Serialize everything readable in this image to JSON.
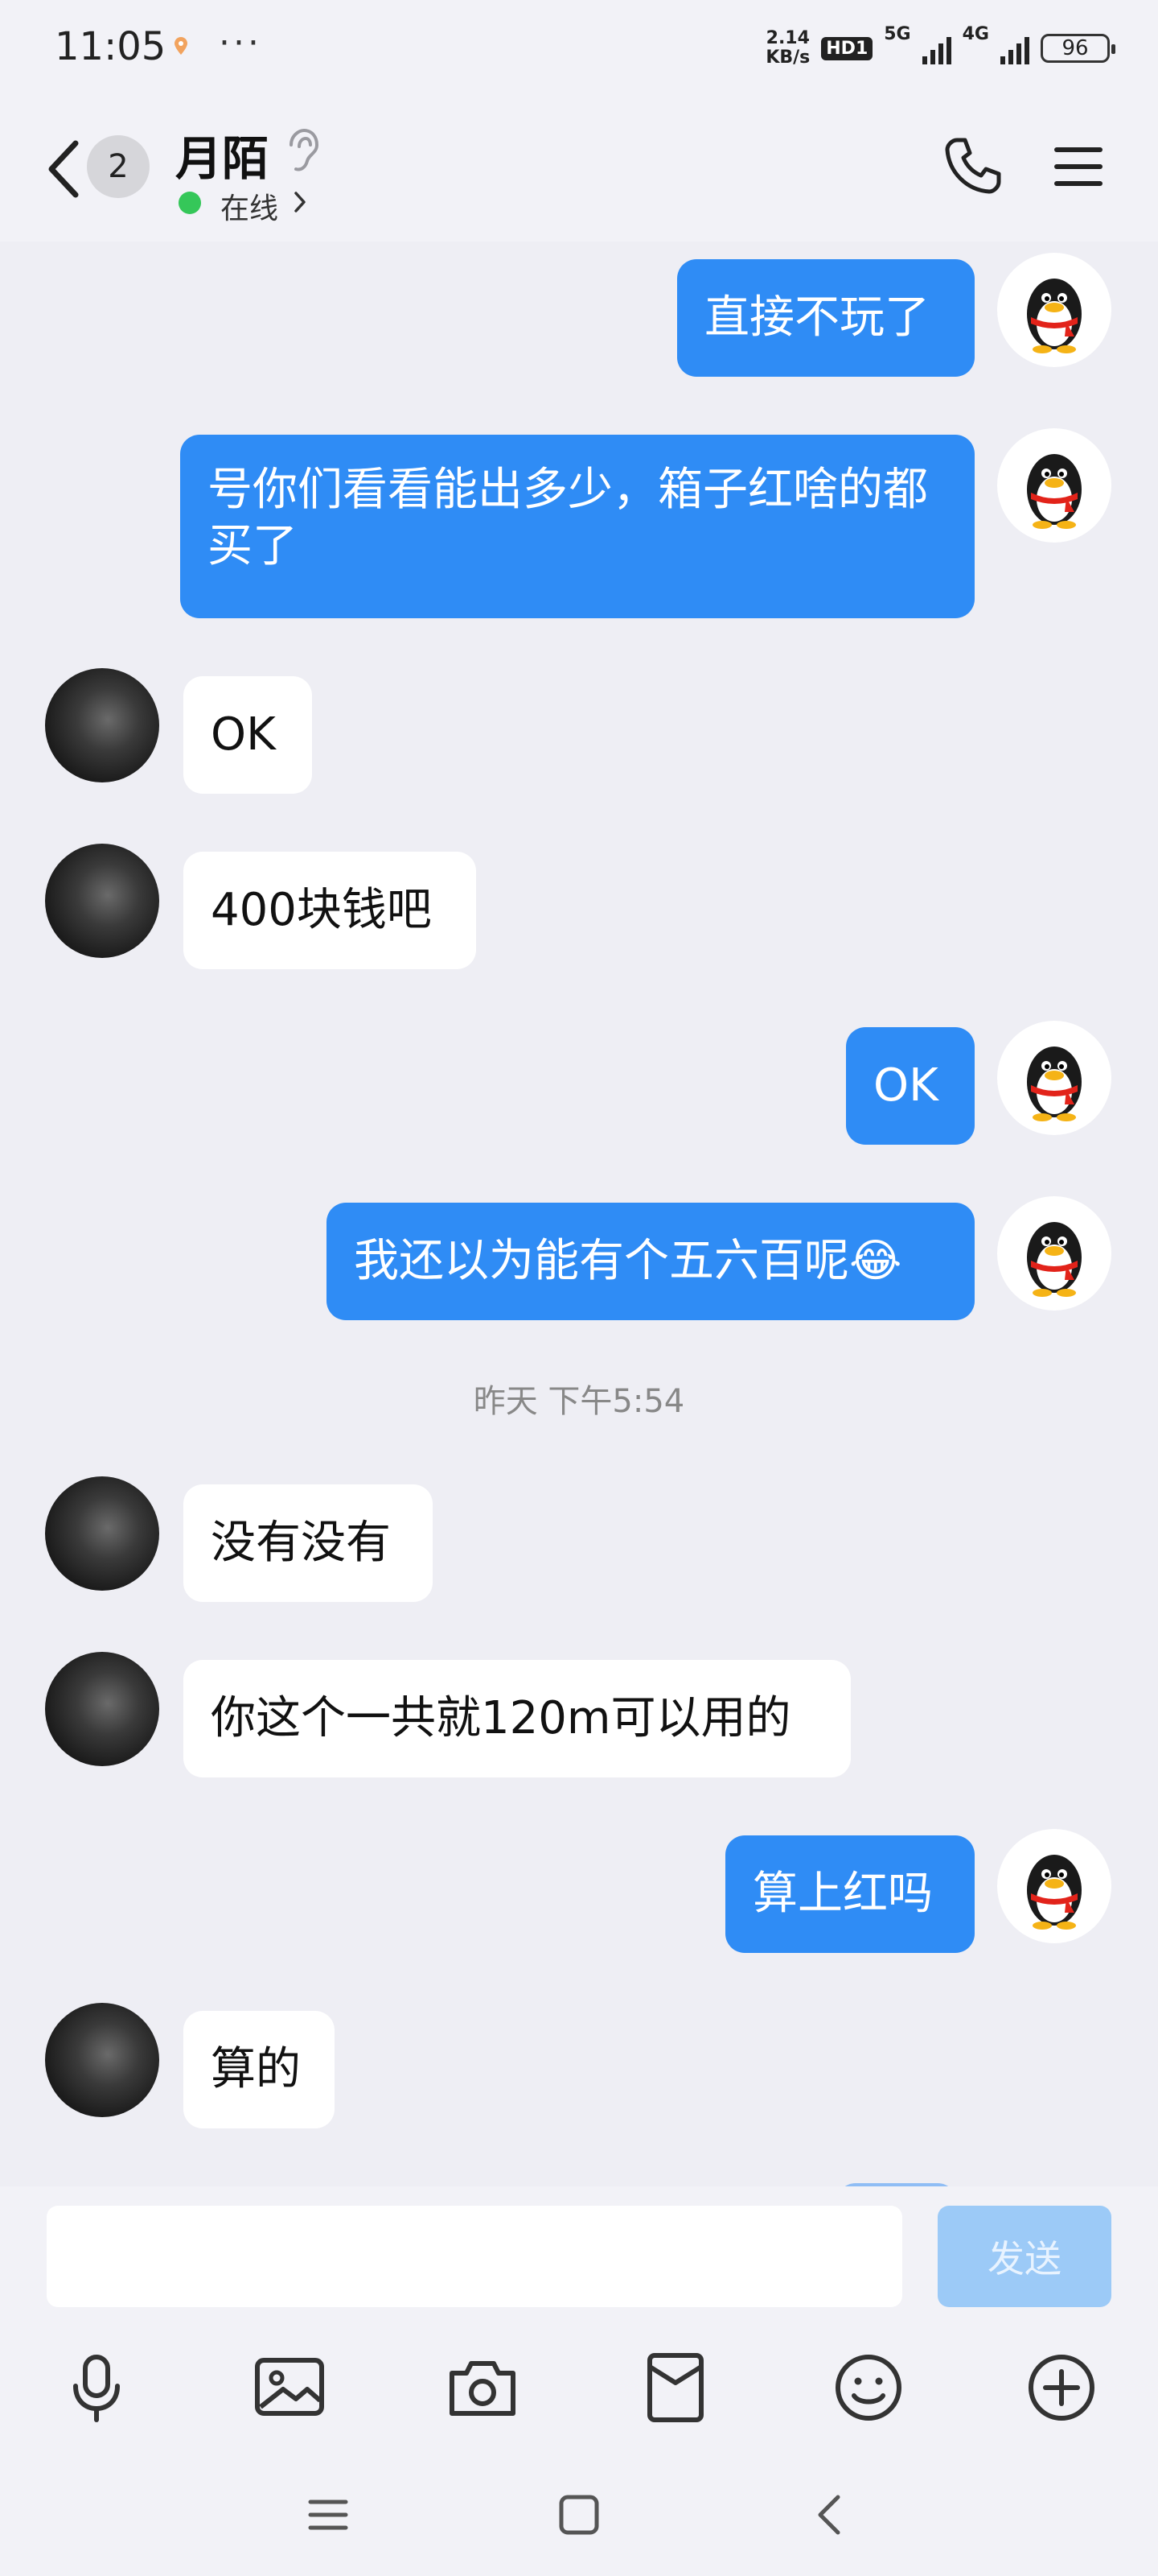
{
  "status_bar": {
    "time": "11:05",
    "dots": "···",
    "speed_top": "2.14",
    "speed_bottom": "KB/s",
    "hd": "HD1",
    "net1": "5G",
    "net2": "4G",
    "battery": "96"
  },
  "header": {
    "back_badge": "2",
    "contact_name": "月陌",
    "status": "在线"
  },
  "messages": [
    {
      "dir": "out",
      "text": "直接不玩了"
    },
    {
      "dir": "out",
      "text": "号你们看看能出多少，箱子红啥的都买了"
    },
    {
      "dir": "in",
      "text": "OK"
    },
    {
      "dir": "in",
      "text": "400块钱吧"
    },
    {
      "dir": "out",
      "text": "OK"
    },
    {
      "dir": "out",
      "text": "我还以为能有个五六百呢😂"
    },
    {
      "dir": "in",
      "text": "没有没有"
    },
    {
      "dir": "in",
      "text": "你这个一共就120m可以用的"
    },
    {
      "dir": "out",
      "text": "算上红吗"
    },
    {
      "dir": "in",
      "text": "算的"
    }
  ],
  "timestamp": "昨天 下午5:54",
  "input": {
    "placeholder": "",
    "value": "",
    "send_label": "发送"
  },
  "toolbar_icons": [
    "microphone-icon",
    "image-icon",
    "camera-icon",
    "red-packet-icon",
    "emoji-icon",
    "plus-icon"
  ],
  "nav_icons": [
    "menu-icon",
    "home-icon",
    "back-icon"
  ],
  "colors": {
    "outgoing_bubble": "#2f8cf5",
    "incoming_bubble": "#ffffff",
    "background": "#eeeef4",
    "online": "#35c759",
    "send_disabled": "#9ccaf7"
  }
}
